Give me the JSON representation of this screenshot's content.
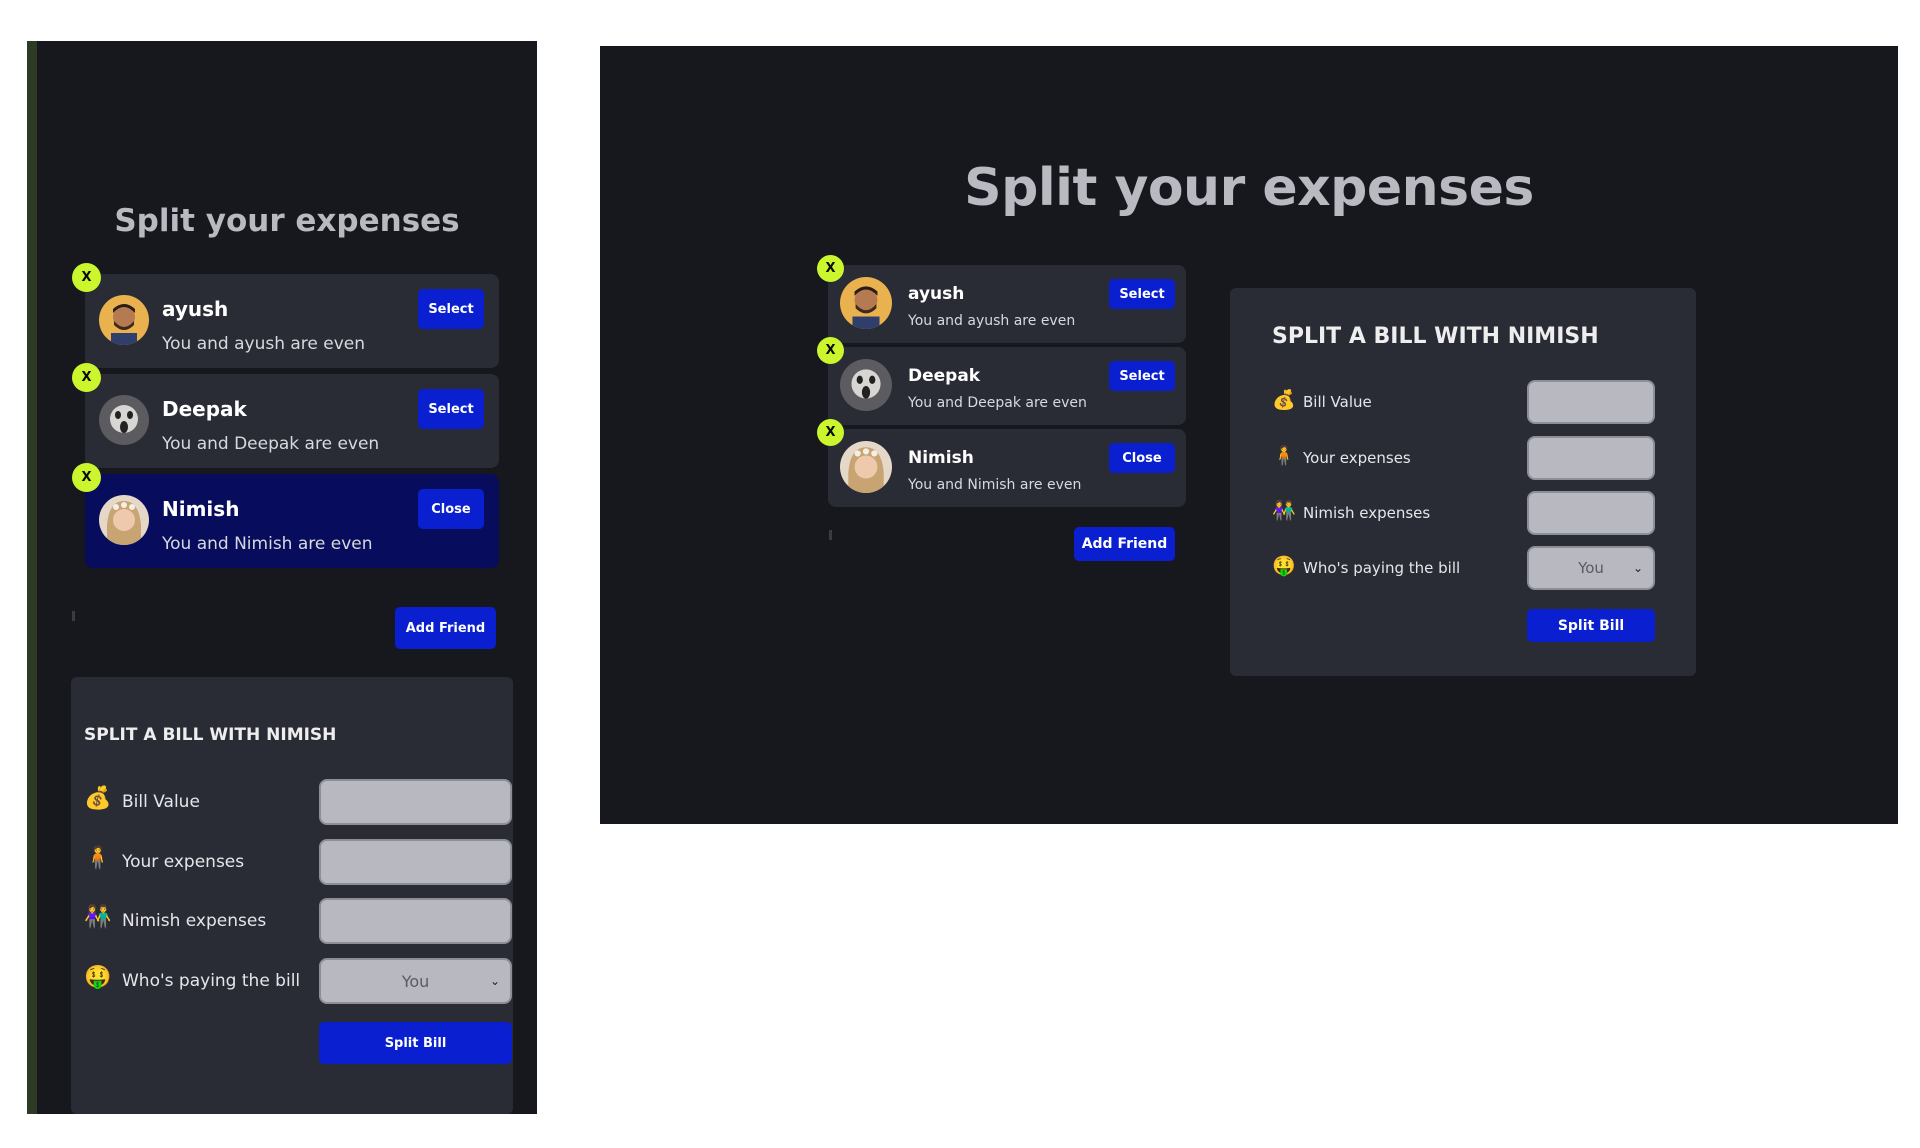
{
  "app": {
    "title": "Split your expenses",
    "friends": [
      {
        "name": "ayush",
        "status": "You and ayush are even",
        "button": "Select",
        "remove": "X",
        "selected": false,
        "avatar_icon": "man-avatar-icon"
      },
      {
        "name": "Deepak",
        "status": "You and Deepak are even",
        "button": "Select",
        "remove": "X",
        "selected": false,
        "avatar_icon": "scream-face-avatar-icon"
      },
      {
        "name": "Nimish",
        "status": "You and Nimish are even",
        "button": "Close",
        "remove": "X",
        "selected": true,
        "avatar_icon": "woman-flower-crown-avatar-icon"
      }
    ],
    "add_friend": "Add Friend",
    "split_form": {
      "title": "SPLIT A BILL WITH NIMISH",
      "bill_label": "Bill Value",
      "your_label": "Your expenses",
      "friend_label": "Nimish expenses",
      "payer_label": "Who's paying the bill",
      "payer_value": "You",
      "submit": "Split Bill",
      "icons": {
        "bill": {
          "name": "money-bag-icon",
          "glyph": "💰"
        },
        "your": {
          "name": "person-icon",
          "glyph": "🧍"
        },
        "friend": {
          "name": "people-holding-hands-icon",
          "glyph": "👫"
        },
        "payer": {
          "name": "money-mouth-face-icon",
          "glyph": "🤑"
        }
      }
    }
  },
  "colors": {
    "background": "#17181d",
    "card": "#2a2c35",
    "selected_card": "#070d5c",
    "accent_button": "#0a1fd0",
    "remove_badge": "#cbf52d",
    "input_fill": "#b7b8c0"
  }
}
